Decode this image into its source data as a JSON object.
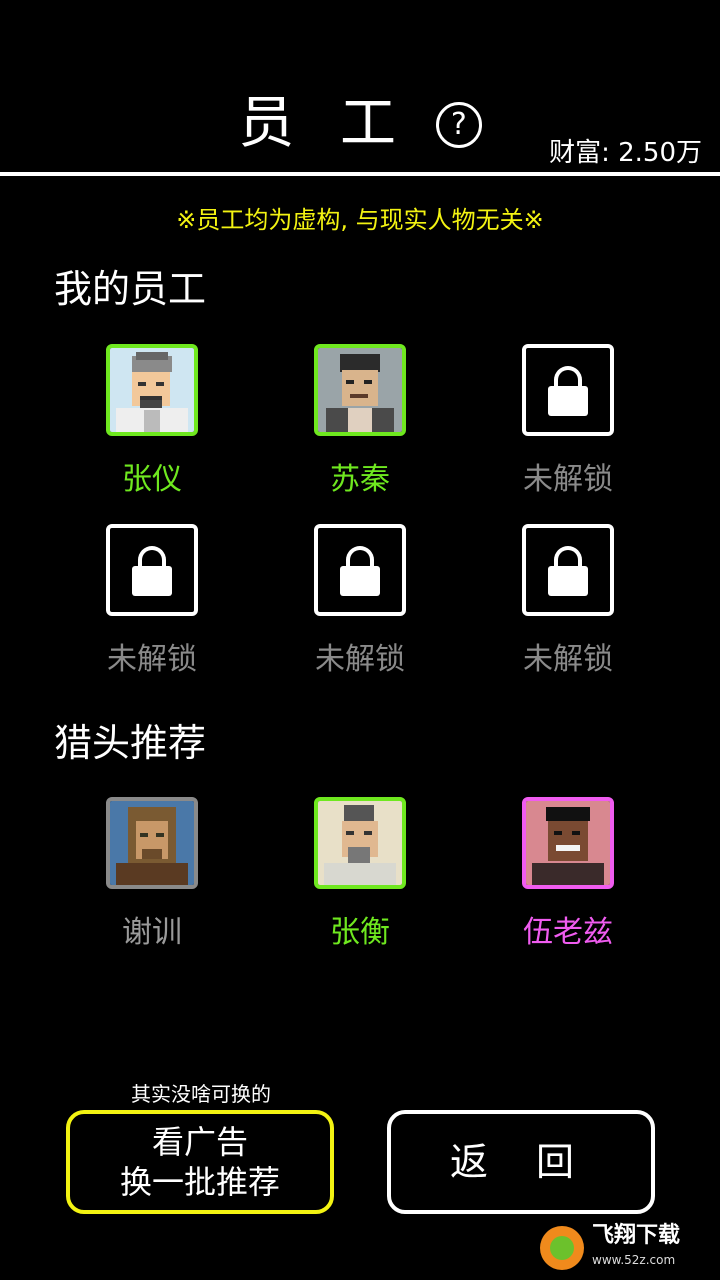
{
  "header": {
    "title": "员 工",
    "help_symbol": "?",
    "wealth": "财富: 2.50万"
  },
  "notice": "※员工均为虚构, 与现实人物无关※",
  "my_staff": {
    "heading": "我的员工",
    "slots": [
      {
        "name": "张仪",
        "state": "unlocked",
        "color": "#6fe81f"
      },
      {
        "name": "苏秦",
        "state": "unlocked",
        "color": "#6fe81f"
      },
      {
        "name": "未解锁",
        "state": "locked",
        "color": "#8a8a8a"
      },
      {
        "name": "未解锁",
        "state": "locked",
        "color": "#8a8a8a"
      },
      {
        "name": "未解锁",
        "state": "locked",
        "color": "#8a8a8a"
      },
      {
        "name": "未解锁",
        "state": "locked",
        "color": "#8a8a8a"
      }
    ]
  },
  "headhunter": {
    "heading": "猎头推荐",
    "slots": [
      {
        "name": "谢训",
        "color": "#9a9a9a"
      },
      {
        "name": "张衡",
        "color": "#6fe81f"
      },
      {
        "name": "伍老兹",
        "color": "#f05cf0"
      }
    ]
  },
  "footer": {
    "hint": "其实没啥可换的",
    "ad_button_line1": "看广告",
    "ad_button_line2": "换一批推荐",
    "back_button": "返 回"
  },
  "watermark": {
    "text": "飞翔下载",
    "url": "www.52z.com"
  }
}
